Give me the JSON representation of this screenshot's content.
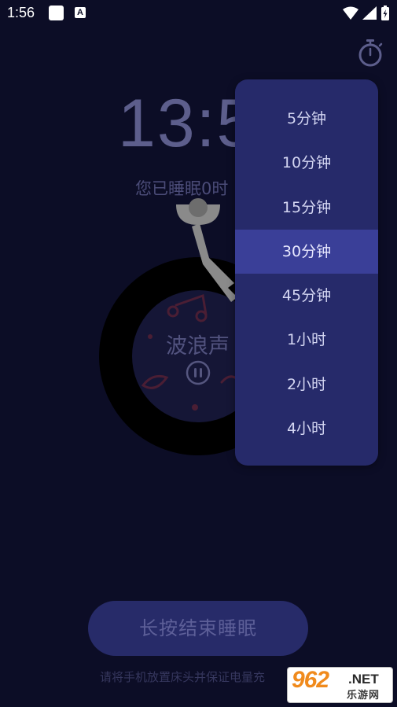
{
  "status_bar": {
    "time": "1:56",
    "notification_icon": "A"
  },
  "main": {
    "clock_visible": "13:5",
    "slept_text_visible": "您已睡眠0时",
    "sound_name": "波浪声"
  },
  "timer_menu": {
    "options": [
      "5分钟",
      "10分钟",
      "15分钟",
      "30分钟",
      "45分钟",
      "1小时",
      "2小时",
      "4小时"
    ],
    "selected": "30分钟"
  },
  "end_button": {
    "label": "长按结束睡眠"
  },
  "hint_visible": "请将手机放置床头并保证电量充",
  "watermark": {
    "number": "962",
    "net": ".NET",
    "chinese": "乐游网"
  },
  "colors": {
    "background": "#0c0d26",
    "dropdown": "#262a6a",
    "dropdown_selected": "#3a3f98",
    "button": "#272b69",
    "watermark_orange": "#f08a1c"
  }
}
